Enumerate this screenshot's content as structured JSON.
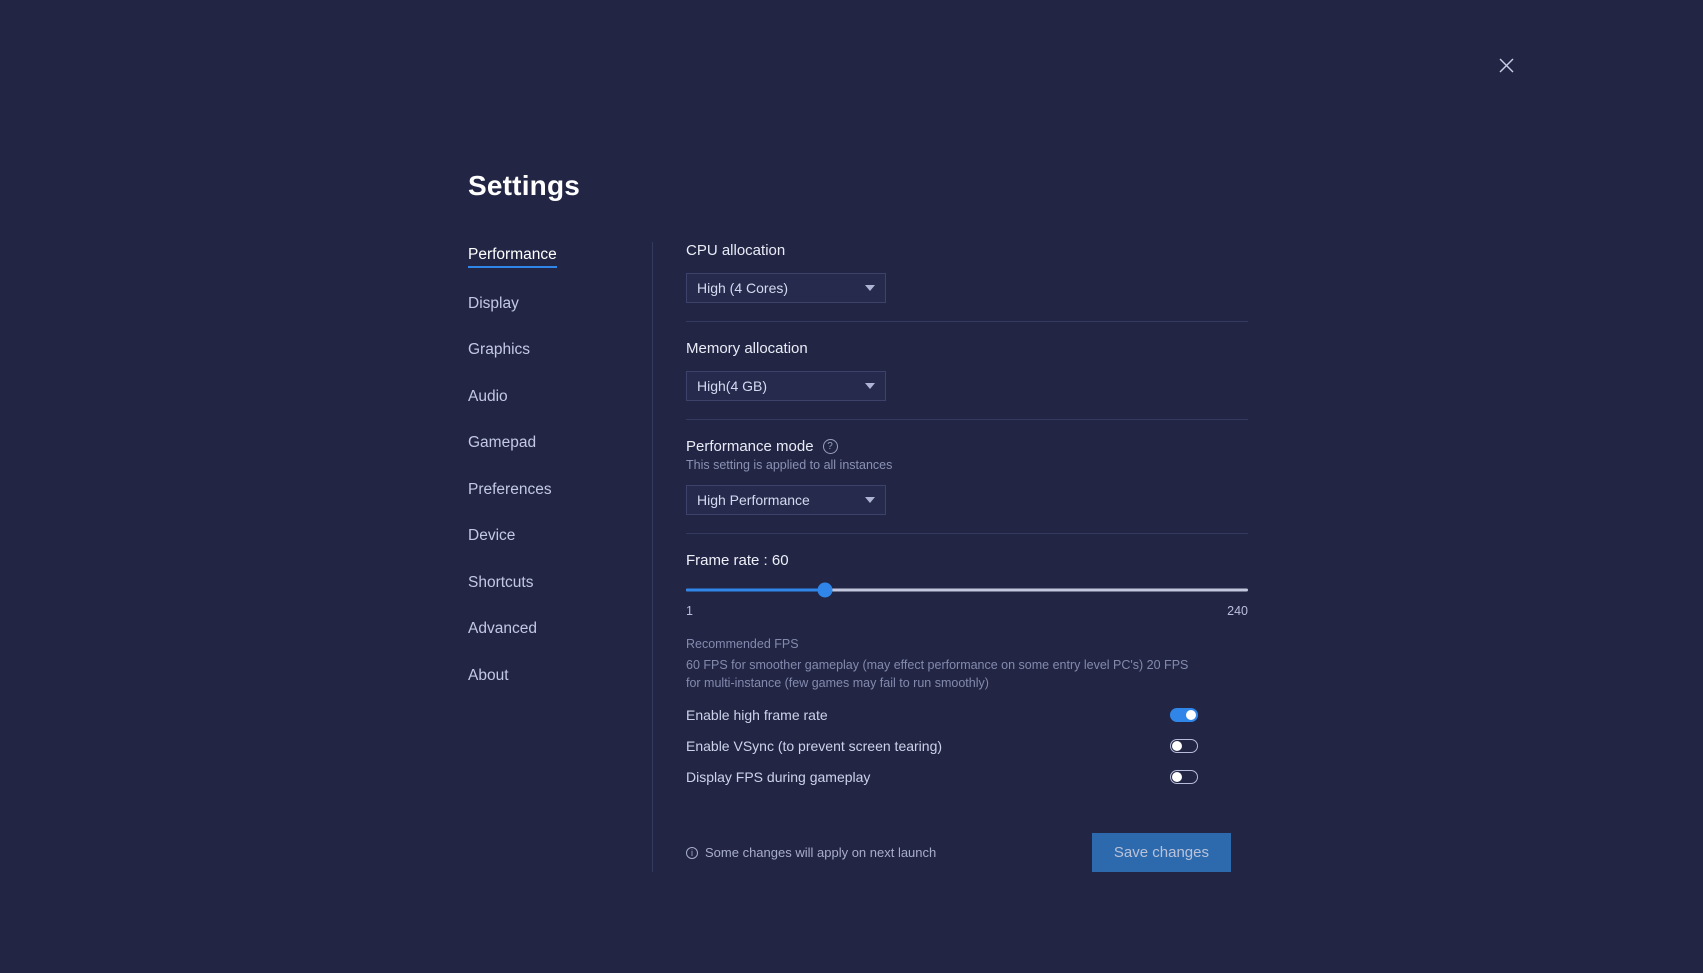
{
  "window": {
    "close_label": "×"
  },
  "page": {
    "title": "Settings"
  },
  "sidebar": {
    "items": [
      {
        "label": "Performance",
        "active": true
      },
      {
        "label": "Display",
        "active": false
      },
      {
        "label": "Graphics",
        "active": false
      },
      {
        "label": "Audio",
        "active": false
      },
      {
        "label": "Gamepad",
        "active": false
      },
      {
        "label": "Preferences",
        "active": false
      },
      {
        "label": "Device",
        "active": false
      },
      {
        "label": "Shortcuts",
        "active": false
      },
      {
        "label": "Advanced",
        "active": false
      },
      {
        "label": "About",
        "active": false
      }
    ]
  },
  "performance": {
    "cpu": {
      "label": "CPU allocation",
      "value": "High (4 Cores)"
    },
    "memory": {
      "label": "Memory allocation",
      "value": "High(4 GB)"
    },
    "mode": {
      "label": "Performance mode",
      "help_icon": "?",
      "note": "This setting is applied to all instances",
      "value": "High Performance"
    },
    "frame_rate": {
      "label": "Frame rate : 60",
      "value": 60,
      "min_label": "1",
      "max_label": "240",
      "min": 1,
      "max": 240,
      "recommended_title": "Recommended FPS",
      "recommended_body": "60 FPS for smoother gameplay (may effect performance on some entry level PC's) 20 FPS for multi-instance (few games may fail to run smoothly)"
    },
    "toggles": [
      {
        "label": "Enable high frame rate",
        "on": true
      },
      {
        "label": "Enable VSync (to prevent screen tearing)",
        "on": false
      },
      {
        "label": "Display FPS during gameplay",
        "on": false
      }
    ]
  },
  "footer": {
    "info_icon": "i",
    "notice": "Some changes will apply on next launch",
    "save_label": "Save changes"
  },
  "colors": {
    "background": "#222644",
    "accent": "#2f86e8",
    "save_button": "#2d69ad",
    "field_background": "#262b4d",
    "muted_text": "#838aae"
  }
}
